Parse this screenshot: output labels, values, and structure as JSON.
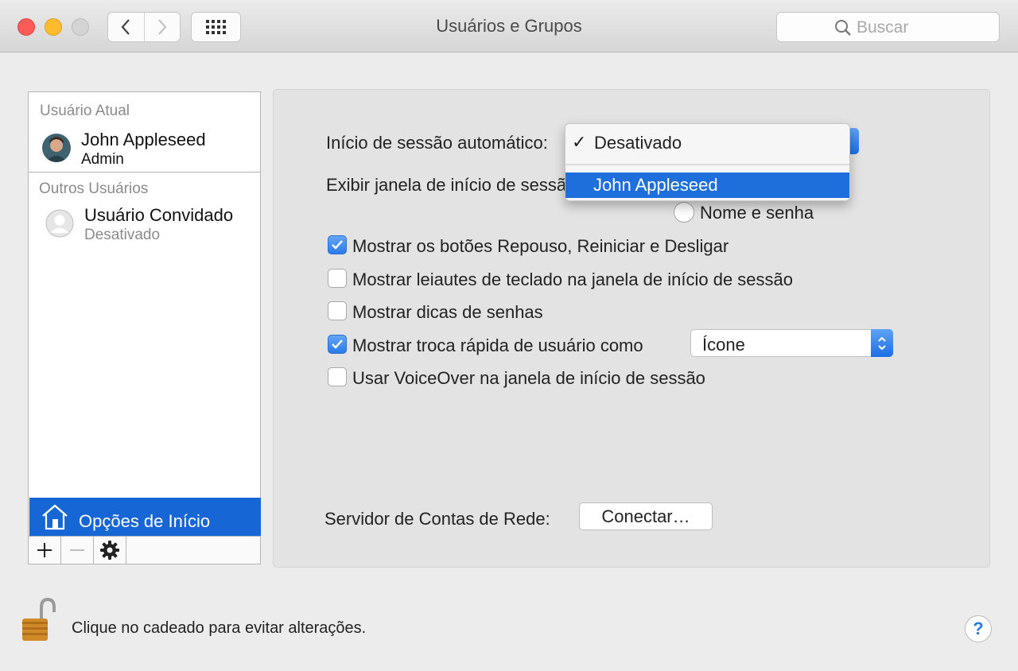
{
  "window": {
    "title": "Usuários e Grupos",
    "search_placeholder": "Buscar"
  },
  "sidebar": {
    "current_section": "Usuário Atual",
    "current_user": {
      "name": "John Appleseed",
      "role": "Admin"
    },
    "other_section": "Outros Usuários",
    "guest_user": {
      "name": "Usuário Convidado",
      "status": "Desativado"
    },
    "login_options": "Opções de Início",
    "add_label": "+",
    "remove_label": "—"
  },
  "panel": {
    "auto_login_label": "Início de sessão automático:",
    "display_login_label": "Exibir janela de início de sessão como:",
    "radio_name_password": "Nome e senha",
    "checkboxes": [
      {
        "label": "Mostrar os botões Repouso, Reiniciar e Desligar",
        "checked": true
      },
      {
        "label": "Mostrar leiautes de teclado na janela de início de sessão",
        "checked": false
      },
      {
        "label": "Mostrar dicas de senhas",
        "checked": false
      },
      {
        "label": "Mostrar troca rápida de usuário como",
        "checked": true
      },
      {
        "label": "Usar VoiceOver na janela de início de sessão",
        "checked": false
      }
    ],
    "fast_switch_value": "Ícone",
    "network_server_label": "Servidor de Contas de Rede:",
    "connect_button": "Conectar…"
  },
  "dropdown": {
    "checkmark": "✓",
    "selected": "Desativado",
    "highlighted": "John Appleseed"
  },
  "footer": {
    "lock_text": "Clique no cadeado para evitar alterações.",
    "help_label": "?"
  },
  "colors": {
    "accent": "#1666d6",
    "menu_highlight": "#1e6fdc",
    "close": "#fc5b57",
    "minimize": "#fdbc2e"
  }
}
